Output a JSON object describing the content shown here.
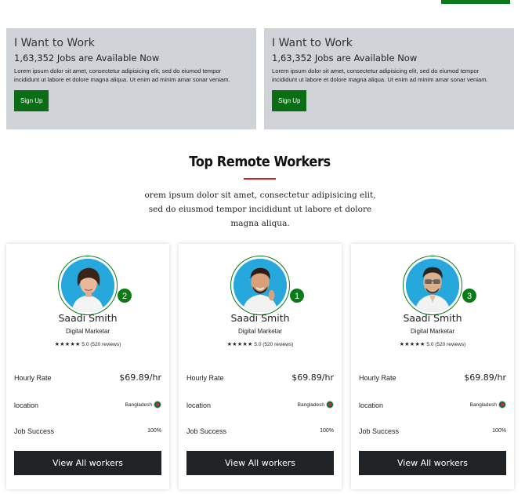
{
  "promos": [
    {
      "title": "I Want to Work",
      "subtitle": "1,63,352 Jobs are Available Now",
      "body": "Lorem ipsum dolor sit amet, consectetur adipisicing elit, sed do eiumod tempor incididunt ut labore et dolore magna aliqua. Ut enim ad minim amar sonar veniam.",
      "button": "Sign Up"
    },
    {
      "title": "I Want to Work",
      "subtitle": "1,63,352 Jobs are Available Now",
      "body": "Lorem ipsum dolor sit amet, consectetur adipisicing elit, sed do eiumod tempor incididunt ut labore et dolore magna aliqua. Ut enim ad minim amar sonar veniam.",
      "button": "Sign Up"
    }
  ],
  "section": {
    "title": "Top Remote Workers",
    "description": "orem ipsum dolor sit amet, consectetur adipisicing elit, sed do eiusmod tempor incididunt ut labore et dolore magna aliqua."
  },
  "workers": [
    {
      "rank": "2",
      "name": "Saadi Smith",
      "role": "Digital Marketar",
      "stars": "★★★★★",
      "rating": "5.0 (520 reviews)",
      "rate_label": "Hourly Rate",
      "rate": "$69.89/hr",
      "location_label": "location",
      "location": "Bangladesh",
      "success_label": "Job Success",
      "success": "100%",
      "button": "View All workers",
      "avatar": "woman-avatar"
    },
    {
      "rank": "1",
      "name": "Saadi Smith",
      "role": "Digital Marketar",
      "stars": "★★★★★",
      "rating": "5.0 (520 reviews)",
      "rate_label": "Hourly Rate",
      "rate": "$69.89/hr",
      "location_label": "location",
      "location": "Bangladesh",
      "success_label": "Job Success",
      "success": "100%",
      "button": "View All workers",
      "avatar": "smiling-man-avatar"
    },
    {
      "rank": "3",
      "name": "Saadi Smith",
      "role": "Digital Marketar",
      "stars": "★★★★★",
      "rating": "5.0 (520 reviews)",
      "rate_label": "Hourly Rate",
      "rate": "$69.89/hr",
      "location_label": "location",
      "location": "Bangladesh",
      "success_label": "Job Success",
      "success": "100%",
      "button": "View All workers",
      "avatar": "glasses-man-avatar"
    }
  ],
  "colors": {
    "accent_green": "#0a7a1a",
    "promo_bg": "#d0d4d9",
    "underline_red": "#c92020",
    "button_dark": "#202326",
    "avatar_bg": "#27a8dd"
  }
}
